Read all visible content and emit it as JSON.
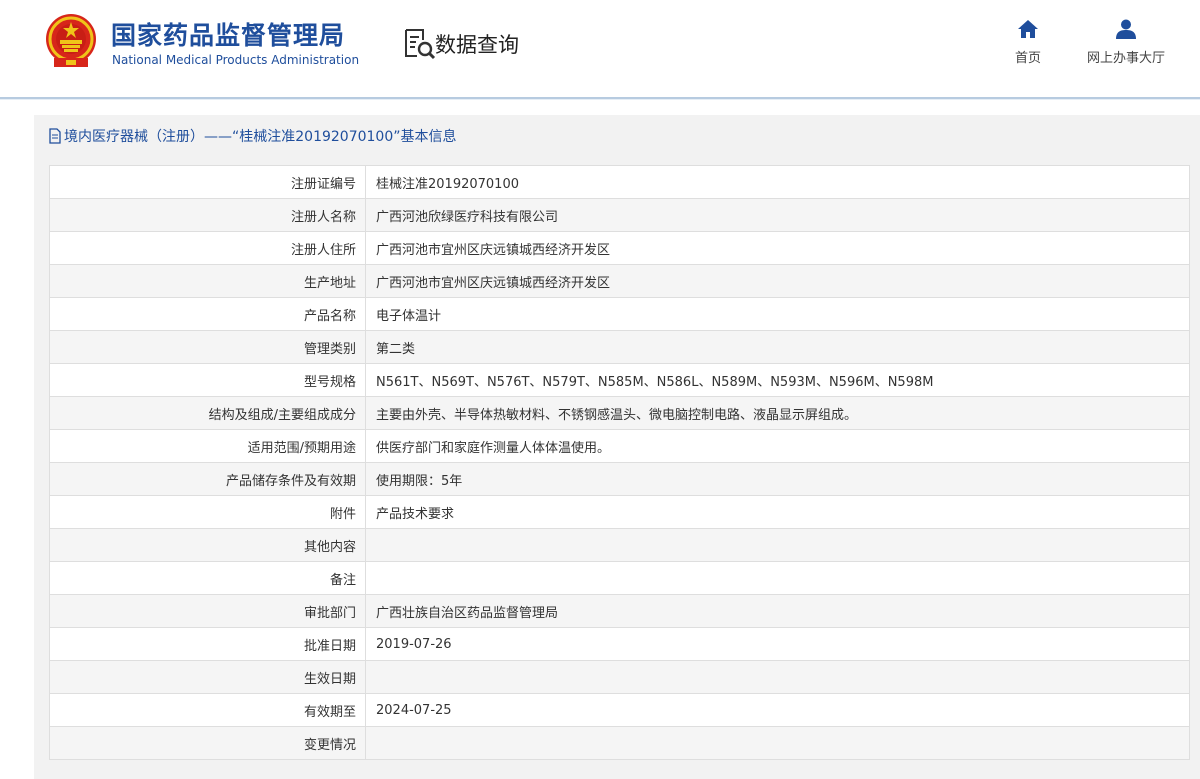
{
  "header": {
    "brand_cn": "国家药品监督管理局",
    "brand_en": "National Medical Products Administration",
    "query_title": "数据查询",
    "nav": [
      {
        "label": "首页",
        "icon": "home-icon"
      },
      {
        "label": "网上办事大厅",
        "icon": "user-icon"
      }
    ]
  },
  "panel": {
    "title": "境内医疗器械（注册）——“桂械注准20192070100”基本信息",
    "rows": [
      {
        "label": "注册证编号",
        "value": "桂械注准20192070100"
      },
      {
        "label": "注册人名称",
        "value": "广西河池欣绿医疗科技有限公司"
      },
      {
        "label": "注册人住所",
        "value": "广西河池市宜州区庆远镇城西经济开发区"
      },
      {
        "label": "生产地址",
        "value": "广西河池市宜州区庆远镇城西经济开发区"
      },
      {
        "label": "产品名称",
        "value": "电子体温计"
      },
      {
        "label": "管理类别",
        "value": "第二类"
      },
      {
        "label": "型号规格",
        "value": "N561T、N569T、N576T、N579T、N585M、N586L、N589M、N593M、N596M、N598M"
      },
      {
        "label": "结构及组成/主要组成成分",
        "value": "主要由外壳、半导体热敏材料、不锈钢感温头、微电脑控制电路、液晶显示屏组成。"
      },
      {
        "label": "适用范围/预期用途",
        "value": "供医疗部门和家庭作测量人体体温使用。"
      },
      {
        "label": "产品储存条件及有效期",
        "value": "使用期限：5年"
      },
      {
        "label": "附件",
        "value": "产品技术要求"
      },
      {
        "label": "其他内容",
        "value": ""
      },
      {
        "label": "备注",
        "value": ""
      },
      {
        "label": "审批部门",
        "value": "广西壮族自治区药品监督管理局"
      },
      {
        "label": "批准日期",
        "value": "2019-07-26"
      },
      {
        "label": "生效日期",
        "value": ""
      },
      {
        "label": "有效期至",
        "value": "2024-07-25"
      },
      {
        "label": "变更情况",
        "value": ""
      }
    ]
  },
  "colors": {
    "brand_blue": "#1f4e9c",
    "emblem_red": "#d7261a",
    "emblem_gold": "#f0c419"
  }
}
